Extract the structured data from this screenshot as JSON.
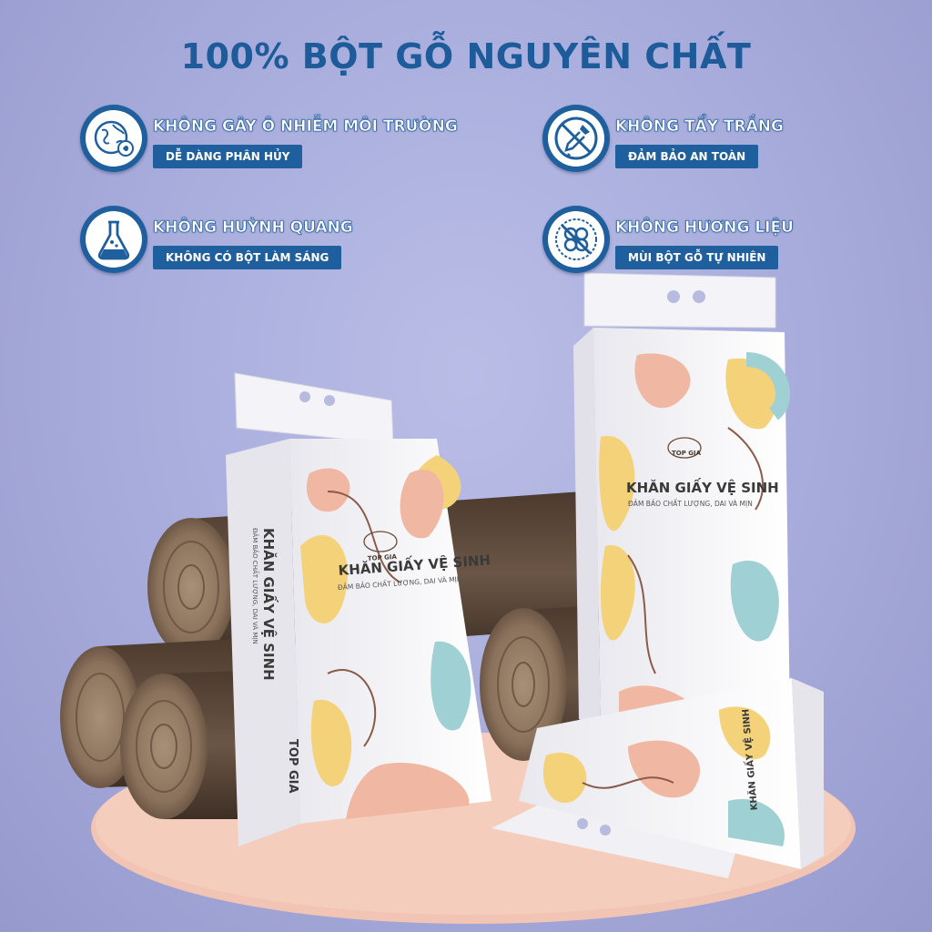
{
  "headline": "100% BỘT GỖ NGUYÊN CHẤT",
  "features": [
    {
      "icon": "globe-leaf-icon",
      "title": "KHÔNG GÂY Ô NHIỄM MÔI TRƯỜNG",
      "subtitle": "DỄ DÀNG PHÂN HỦY"
    },
    {
      "icon": "no-dropper-icon",
      "title": "KHÔNG TẨY TRẮNG",
      "subtitle": "ĐẢM BẢO AN TOÀN"
    },
    {
      "icon": "flask-icon",
      "title": "KHÔNG HUỲNH QUANG",
      "subtitle": "KHÔNG CÓ BỘT LÀM SÁNG"
    },
    {
      "icon": "no-fragrance-icon",
      "title": "KHÔNG HƯƠNG LIỆU",
      "subtitle": "MÙI BỘT GỖ TỰ NHIÊN"
    }
  ],
  "product": {
    "brand": "TOP GIA",
    "name": "KHĂN GIẤY VỆ SINH",
    "tagline": "ĐẢM BẢO CHẤT LƯỢNG, DAI VÀ MỊN"
  },
  "colors": {
    "brand_blue": "#1f5f9e",
    "peach": "#f0b8a2",
    "yellow": "#f3d27a",
    "teal": "#9fd0d4",
    "wood": "#5c4838"
  }
}
